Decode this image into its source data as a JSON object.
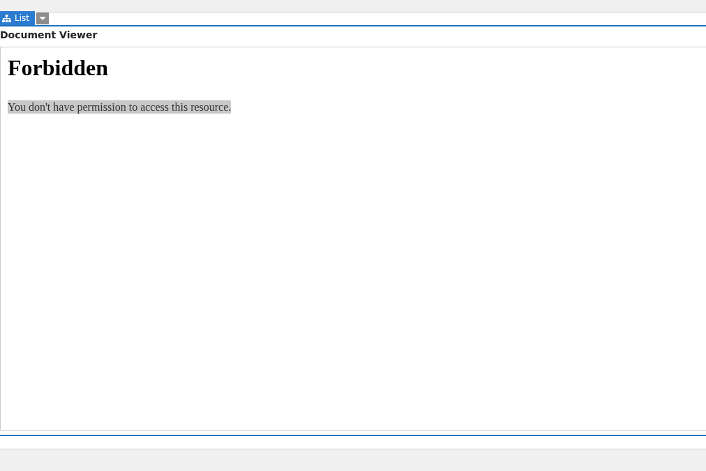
{
  "toolbar": {
    "view_tab": {
      "label": "List",
      "selected": true
    }
  },
  "panel": {
    "title": "Document Viewer"
  },
  "document": {
    "heading": "Forbidden",
    "message": "You don't have permission to access this resource.",
    "message_highlighted": true
  }
}
